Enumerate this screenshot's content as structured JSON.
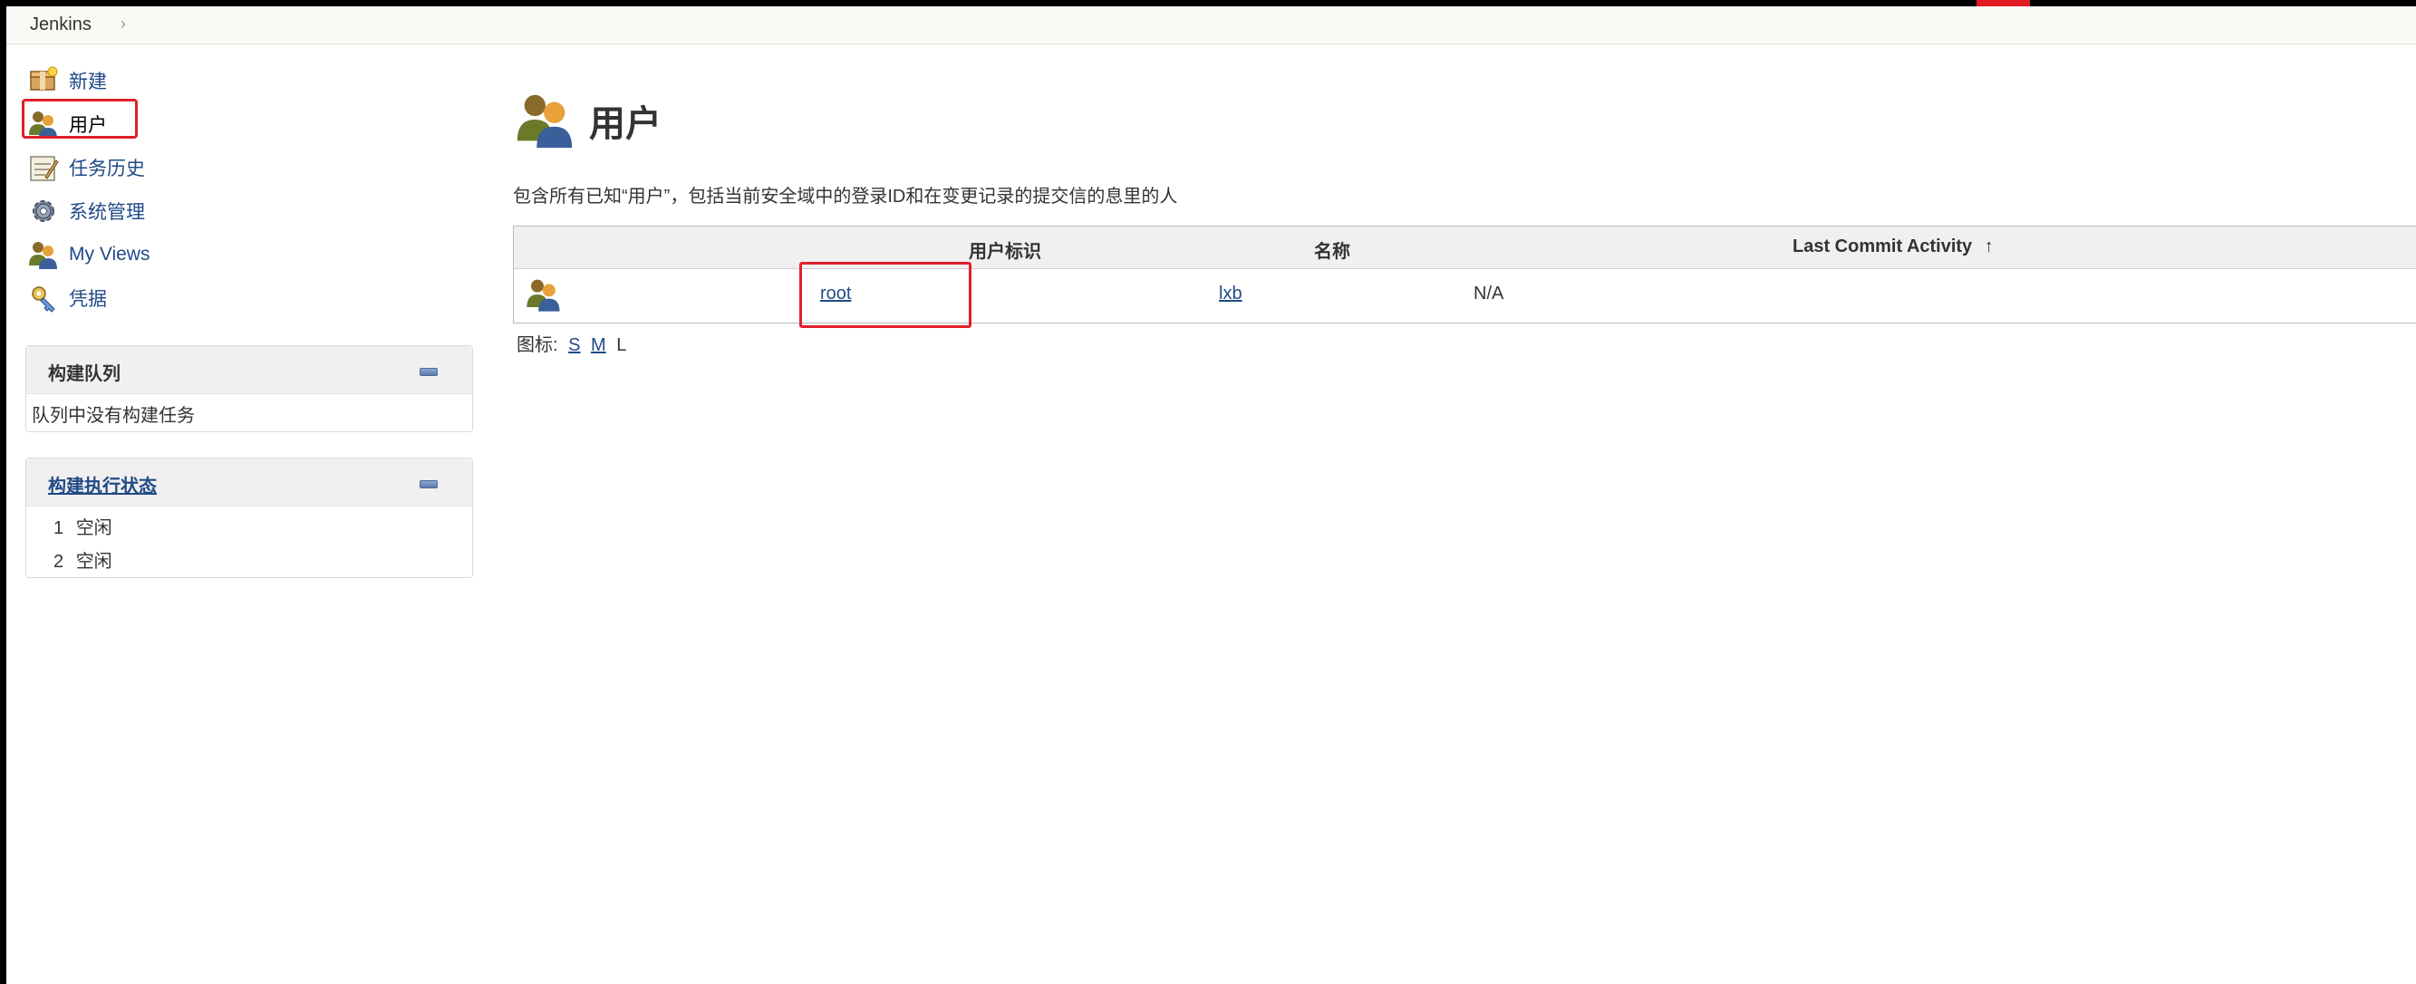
{
  "breadcrumb": {
    "home": "Jenkins",
    "separator": "›"
  },
  "sidebar": {
    "items": [
      {
        "label": "新建",
        "icon": "new-item-icon"
      },
      {
        "label": "用户",
        "icon": "people-icon"
      },
      {
        "label": "任务历史",
        "icon": "build-history-icon"
      },
      {
        "label": "系统管理",
        "icon": "gear-icon"
      },
      {
        "label": "My Views",
        "icon": "people-icon"
      },
      {
        "label": "凭据",
        "icon": "credentials-icon"
      }
    ]
  },
  "build_queue": {
    "title": "构建队列",
    "empty_text": "队列中没有构建任务"
  },
  "executors": {
    "title": "构建执行状态",
    "rows": [
      {
        "num": "1",
        "status": "空闲"
      },
      {
        "num": "2",
        "status": "空闲"
      }
    ]
  },
  "main": {
    "title": "用户",
    "description": "包含所有已知“用户”，包括当前安全域中的登录ID和在变更记录的提交信的息里的人",
    "table": {
      "headers": [
        "用户标识",
        "名称",
        "Last Commit Activity"
      ],
      "sort_arrow": "↑",
      "rows": [
        {
          "user_id": "root",
          "name": "lxb",
          "last_commit": "N/A"
        }
      ]
    },
    "icon_size": {
      "label": "图标:",
      "sizes": [
        "S",
        "M",
        "L"
      ]
    }
  },
  "colors": {
    "link": "#204a87",
    "highlight": "#e0202a",
    "pane_header": "#f0f0f0"
  }
}
